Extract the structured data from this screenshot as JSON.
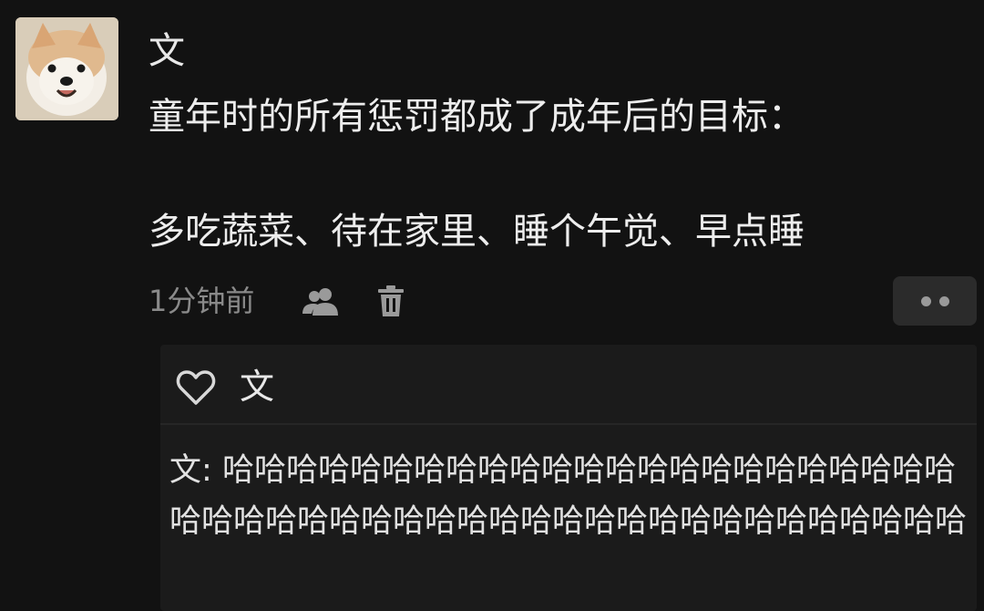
{
  "post": {
    "author": "文",
    "lines": [
      "童年时的所有惩罚都成了成年后的目标：",
      "多吃蔬菜、待在家里、睡个午觉、早点睡"
    ],
    "timestamp": "1分钟前"
  },
  "icons": {
    "avatar": "dog-avatar",
    "visibility": "people-icon",
    "delete": "trash-icon",
    "more": "more-dots-icon",
    "like": "heart-icon"
  },
  "likes": {
    "names": "文"
  },
  "comment": {
    "author": "文",
    "separator": ": ",
    "text": "哈哈哈哈哈哈哈哈哈哈哈哈哈哈哈哈哈哈哈哈哈哈哈哈哈哈哈哈哈哈哈哈哈哈哈哈哈哈哈哈哈哈哈哈哈哈哈哈"
  },
  "colors": {
    "background": "#121212",
    "panel": "#1b1b1b",
    "text": "#ededed",
    "muted": "#8a8a8a"
  }
}
